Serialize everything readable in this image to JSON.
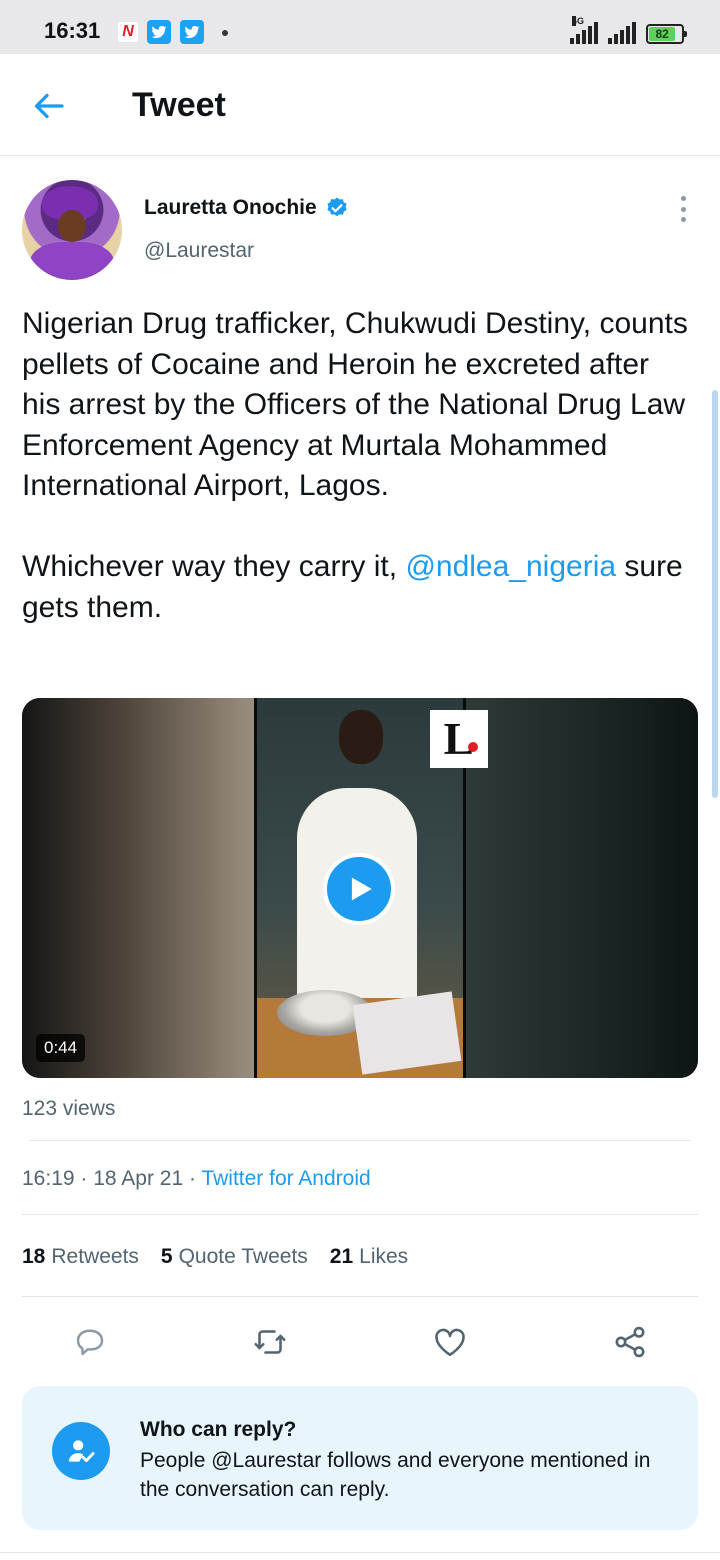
{
  "status_bar": {
    "time": "16:31",
    "notif_icons": [
      "news-app-icon",
      "twitter-icon",
      "twitter-icon"
    ],
    "network_label": "4G",
    "battery": "82",
    "battery_level": 0.82
  },
  "header": {
    "back_icon": "arrow-left-icon",
    "title": "Tweet"
  },
  "tweet": {
    "author_name": "Lauretta Onochie",
    "verified": true,
    "handle": "@Laurestar",
    "text_paragraph_1": "Nigerian Drug trafficker, Chukwudi Destiny, counts pellets of Cocaine and Heroin he excreted after his arrest by the Officers of the National Drug Law Enforcement Agency at Murtala Mohammed International Airport, Lagos.",
    "text_paragraph_2_prefix": "Whichever way they carry it, ",
    "mention": "@ndlea_nigeria",
    "text_paragraph_2_suffix": " sure gets them.",
    "video": {
      "duration": "0:44",
      "watermark": "L"
    },
    "views": "123 views",
    "time": "16:19",
    "date": "18 Apr 21",
    "source": "Twitter for Android",
    "stats": {
      "retweets_count": "18",
      "retweets_label": "Retweets",
      "quotes_count": "5",
      "quotes_label": "Quote Tweets",
      "likes_count": "21",
      "likes_label": "Likes"
    }
  },
  "actions": [
    "reply-icon",
    "retweet-icon",
    "like-icon",
    "share-icon"
  ],
  "who_can_reply": {
    "title": "Who can reply?",
    "description": "People @Laurestar follows and everyone mentioned in the conversation can reply."
  },
  "colors": {
    "accent": "#1d9bf0",
    "text": "#0f1419",
    "secondary": "#536471",
    "reply_bg": "#e8f5fd"
  }
}
